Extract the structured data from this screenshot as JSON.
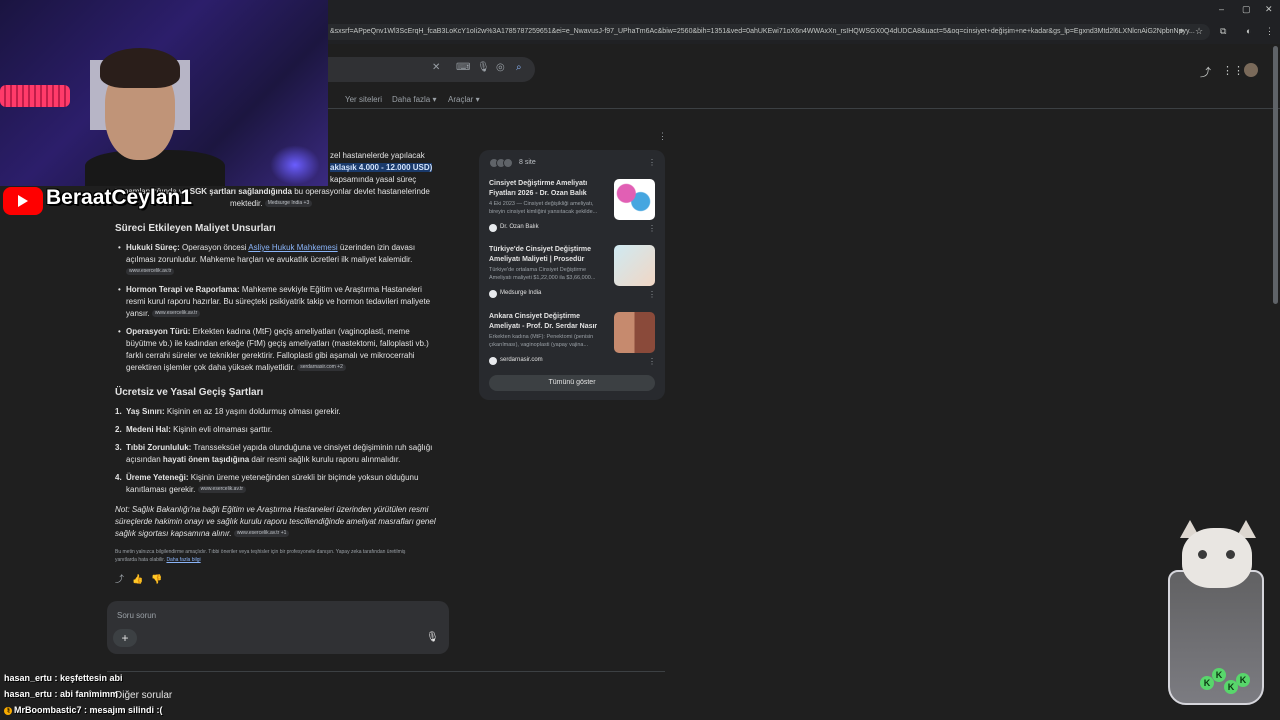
{
  "browser": {
    "url": "&sxsrf=APpeQnv1Wl3ScErqH_fcaB3LoKcY1oIi2w%3A1785787259651&ei=e_NwavusJ-f97_UPhaTm6Ac&biw=2560&bih=1351&ved=0ahUKEwi71oX6n4WWAxXn_rsIHQWSGX0Q4dUDCA8&uact=5&oq=cinsiyet+değişim+ne+kadar&gs_lp=Egxnd3Mtd2l6LXNlcnAiG2NpbnNpyy..."
  },
  "tabs": {
    "web": "Yer siteleri",
    "more": "Daha fazla",
    "tools": "Araçlar"
  },
  "overview": {
    "intro_line1": "zel hastanelerde yapılacak",
    "intro_price": "aklaşık 4.000 - 12.000 USD)",
    "intro_line3": "kapsamında yasal süreç",
    "intro_line4a": "tamamlandığında ve",
    "intro_line4b": "SGK şartları sağlandığında",
    "intro_line4c": "bu operasyonlar devlet hastanelerinde",
    "intro_line5": "mektedir.",
    "intro_chip": "Medsurge India +3",
    "section1_title": "Süreci Etkileyen Maliyet Unsurları",
    "s1_items": [
      {
        "bold": "Hukuki Süreç:",
        "text_a": "Operasyon öncesi ",
        "link": "Asliye Hukuk Mahkemesi",
        "text_b": " üzerinden izin davası açılması zorunludur. Mahkeme harçları ve avukatlık ücretleri ilk maliyet kalemidir.",
        "chip": "www.esercelik.av.tr"
      },
      {
        "bold": "Hormon Terapi ve Raporlama:",
        "text": " Mahkeme sevkiyle Eğitim ve Araştırma Hastaneleri resmi kurul raporu hazırlar. Bu süreçteki psikiyatrik takip ve hormon tedavileri maliyete yansır.",
        "chip": "www.esercelik.av.tr"
      },
      {
        "bold": "Operasyon Türü:",
        "text": " Erkekten kadına (MtF) geçiş ameliyatları (vaginoplasti, meme büyütme vb.) ile kadından erkeğe (FtM) geçiş ameliyatları (mastektomi, falloplasti vb.) farklı cerrahi süreler ve teknikler gerektirir. Falloplasti gibi aşamalı ve mikrocerrahi gerektiren işlemler çok daha yüksek maliyetlidir.",
        "chip": "serdarnasir.com +2"
      }
    ],
    "section2_title": "Ücretsiz ve Yasal Geçiş Şartları",
    "s2_items": [
      {
        "num": "1.",
        "bold": "Yaş Sınırı:",
        "text": " Kişinin en az 18 yaşını doldurmuş olması gerekir."
      },
      {
        "num": "2.",
        "bold": "Medeni Hal:",
        "text": " Kişinin evli olmaması şarttır."
      },
      {
        "num": "3.",
        "bold": "Tıbbi Zorunluluk:",
        "text_a": " Transseksüel yapıda olunduğuna ve cinsiyet değişiminin ruh sağlığı açısından ",
        "bold2": "hayati önem taşıdığına",
        "text_b": " dair resmi sağlık kurulu raporu alınmalıdır."
      },
      {
        "num": "4.",
        "bold": "Üreme Yeteneği:",
        "text": " Kişinin üreme yeteneğinden sürekli bir biçimde yoksun olduğunu kanıtlaması gerekir.",
        "chip": "www.esercelik.av.tr"
      }
    ],
    "note": "Not: Sağlık Bakanlığı'na bağlı Eğitim ve Araştırma Hastaneleri üzerinden yürütülen resmi süreçlerde hakimin onayı ve sağlık kurulu raporu tescillendiğinde ameliyat masrafları genel sağlık sigortası kapsamına alınır.",
    "note_chip": "www.esercelik.av.tr +1",
    "disclaimer": "Bu metin yalnızca bilgilendirme amaçlıdır. Tıbbi öneriler veya teşhisler için bir profesyonele danışın. Yapay zeka tarafından üretilmiş yanıtlarda hata olabilir.",
    "disclaimer_link": "Daha fazla bilgi"
  },
  "ask": {
    "placeholder": "Soru sorun",
    "plus": "+"
  },
  "sources": {
    "count_label": "8 site",
    "items": [
      {
        "title": "Cinsiyet Değiştirme Ameliyatı Fiyatları 2026 - Dr. Ozan Balık",
        "snippet": "4 Eki 2023 — Cinsiyet değişikliği ameliyatı, bireyin cinsiyet kimliğini yansıtacak şekilde...",
        "site": "Dr. Ozan Balık"
      },
      {
        "title": "Türkiye'de Cinsiyet Değiştirme Ameliyatı Maliyeti | Prosedür",
        "snippet": "Türkiye'de ortalama Cinsiyet Değiştirme Ameliyatı maliyeti $1,22,000 ila $3,66,000...",
        "site": "Medsurge India"
      },
      {
        "title": "Ankara Cinsiyet Değiştirme Ameliyatı - Prof. Dr. Serdar Nasır",
        "snippet": "Erkekten kadına (MtF): Penektomi (penisin çıkarılması), vaginoplasti (yapay vajina...",
        "site": "serdarnasir.com"
      }
    ],
    "show_all": "Tümünü göster"
  },
  "stream": {
    "name": "BeraatCeylan1",
    "chat": [
      {
        "user": "hasan_ertu",
        "msg": "keşfettesin abi"
      },
      {
        "user": "hasan_ertu",
        "msg": "abi fanîmimm"
      },
      {
        "user": "MrBoombastic7",
        "msg": "mesajım silindi :("
      }
    ]
  },
  "more_questions": "Diğer sorular",
  "colors": {
    "accent": "#8ab4f8",
    "highlight": "#1a3a6b",
    "youtube": "#ff0000",
    "kbadge": "#58d66b"
  }
}
